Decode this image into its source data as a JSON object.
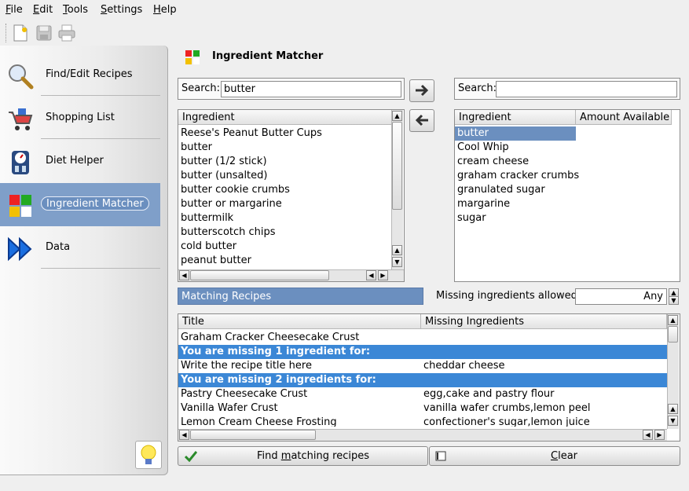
{
  "menu": [
    {
      "key": "file",
      "accel": "F",
      "rest": "ile"
    },
    {
      "key": "edit",
      "accel": "E",
      "rest": "dit"
    },
    {
      "key": "tools",
      "accel": "T",
      "rest": "ools"
    },
    {
      "key": "settings",
      "accel": "S",
      "rest": "ettings"
    },
    {
      "key": "help",
      "accel": "H",
      "rest": "elp"
    }
  ],
  "toolbar": {
    "icons": [
      "new-document-icon",
      "save-icon",
      "print-icon"
    ]
  },
  "sidebar": {
    "items": [
      {
        "label": "Find/Edit Recipes",
        "icon": "magnifier-icon"
      },
      {
        "label": "Shopping List",
        "icon": "shopping-cart-icon"
      },
      {
        "label": "Diet Helper",
        "icon": "scale-icon"
      },
      {
        "label": "Ingredient Matcher",
        "icon": "ingredient-matcher-icon",
        "active": true
      },
      {
        "label": "Data",
        "icon": "fast-forward-icon"
      }
    ],
    "tip_icon": "lightbulb-icon"
  },
  "page": {
    "title": "Ingredient Matcher"
  },
  "left_search": {
    "label": "Search:",
    "value": "butter"
  },
  "right_search": {
    "label": "Search:",
    "value": ""
  },
  "left_list": {
    "header": "Ingredient",
    "items": [
      "Reese's Peanut Butter Cups",
      "butter",
      "butter (1/2 stick)",
      "butter (unsalted)",
      "butter cookie crumbs",
      "butter or margarine",
      "buttermilk",
      "butterscotch chips",
      "cold butter",
      "peanut butter"
    ]
  },
  "right_list": {
    "headers": [
      "Ingredient",
      "Amount Available"
    ],
    "items": [
      "butter",
      "Cool Whip",
      "cream cheese",
      "graham cracker crumbs",
      "granulated sugar",
      "margarine",
      "sugar"
    ],
    "selected": "butter"
  },
  "matching": {
    "label": "Matching Recipes",
    "missing_label": "Missing ingredients allowed:",
    "missing_value": "Any"
  },
  "results": {
    "headers": [
      "Title",
      "Missing Ingredients"
    ],
    "rows": [
      {
        "type": "item",
        "title": "Graham Cracker Cheesecake Crust",
        "missing": ""
      },
      {
        "type": "group",
        "title": "You are missing 1 ingredient for:",
        "missing": ""
      },
      {
        "type": "item",
        "title": "Write the recipe title here",
        "missing": "cheddar cheese"
      },
      {
        "type": "group",
        "title": "You are missing 2 ingredients for:",
        "missing": ""
      },
      {
        "type": "item",
        "title": "Pastry Cheesecake Crust",
        "missing": "egg,cake and pastry flour"
      },
      {
        "type": "item",
        "title": "Vanilla Wafer Crust",
        "missing": "vanilla wafer crumbs,lemon peel"
      },
      {
        "type": "item",
        "title": "Lemon Cream Cheese Frosting",
        "missing": "confectioner's sugar,lemon juice"
      }
    ]
  },
  "buttons": {
    "find_pre": "Find ",
    "find_accel": "m",
    "find_post": "atching recipes",
    "clear_accel": "C",
    "clear_post": "lear"
  }
}
